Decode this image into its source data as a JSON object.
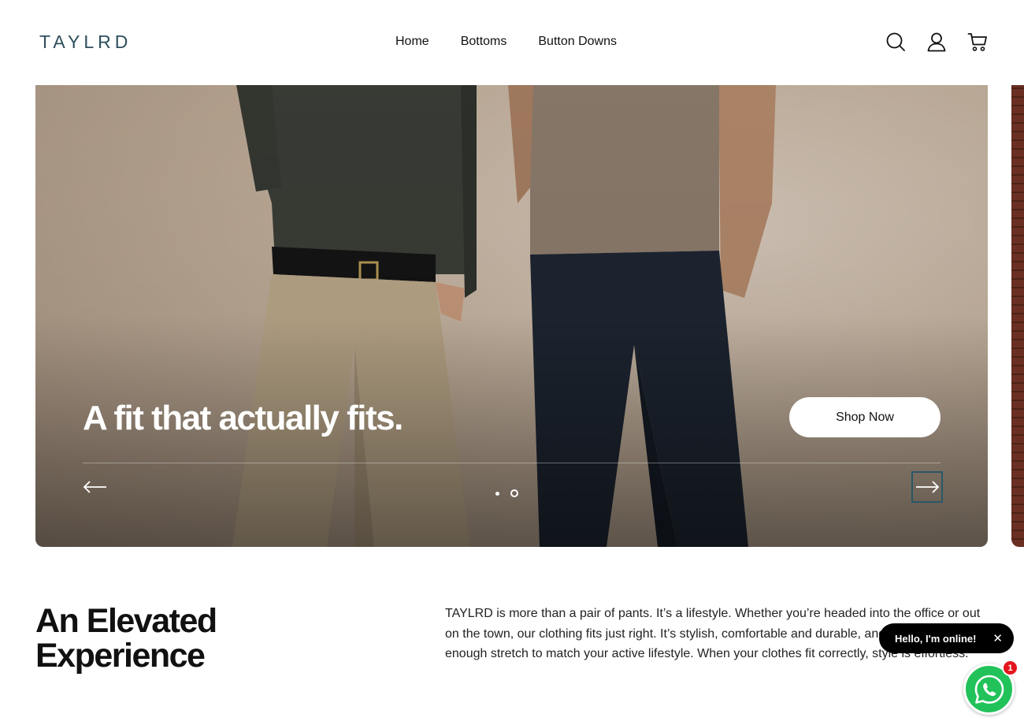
{
  "header": {
    "logo": "TAYLRD",
    "nav": [
      "Home",
      "Bottoms",
      "Button Downs"
    ],
    "icons": [
      "search-icon",
      "account-icon",
      "cart-icon"
    ]
  },
  "hero": {
    "title": "A fit that actually fits.",
    "cta_label": "Shop Now",
    "slide_count": 2,
    "active_slide": 1
  },
  "section": {
    "title_line1": "An Elevated",
    "title_line2": "Experience",
    "body": "TAYLRD is more than a pair of pants. It’s a lifestyle. Whether you’re headed into the office or out on the town, our clothing fits just right. It’s stylish, comfortable and durable, and provides just enough stretch to match your active lifestyle. When your clothes fit correctly, style is effortless."
  },
  "chat": {
    "bubble_text": "Hello, I'm online!",
    "close_symbol": "✕",
    "badge_count": "1"
  },
  "colors": {
    "logo": "#2e4f5c",
    "whatsapp": "#22c25a",
    "badge": "#e4161d",
    "next_arrow_focus": "#2b5766"
  }
}
